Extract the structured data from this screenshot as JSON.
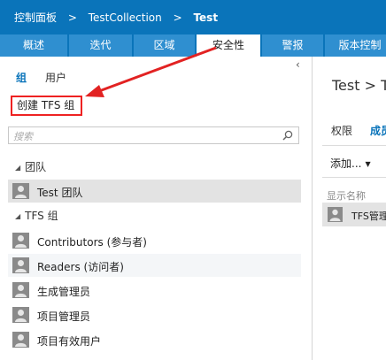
{
  "breadcrumb": {
    "items": [
      "控制面板",
      "TestCollection",
      "Test"
    ],
    "separator": ">"
  },
  "tabs": [
    {
      "label": "概述"
    },
    {
      "label": "迭代"
    },
    {
      "label": "区域"
    },
    {
      "label": "安全性",
      "active": true
    },
    {
      "label": "警报"
    },
    {
      "label": "版本控制"
    }
  ],
  "left": {
    "subtabs": {
      "groups": "组",
      "users": "用户"
    },
    "create_button": "创建 TFS 组",
    "search": {
      "placeholder": "搜索"
    },
    "sections": {
      "teams": "团队",
      "tfs_groups": "TFS 组"
    },
    "team_items": [
      "Test 团队"
    ],
    "group_items": [
      "Contributors (参与者)",
      "Readers (访问者)",
      "生成管理员",
      "项目管理员",
      "项目有效用户"
    ]
  },
  "right": {
    "title": "Test > T",
    "tabs": {
      "permissions": "权限",
      "members": "成员"
    },
    "add_button": "添加...",
    "column_header": "显示名称",
    "member": "TFS管理"
  },
  "colors": {
    "header_blue": "#0a74ba",
    "tab_blue": "#2f8fd0",
    "annotation_red": "#e22222"
  }
}
